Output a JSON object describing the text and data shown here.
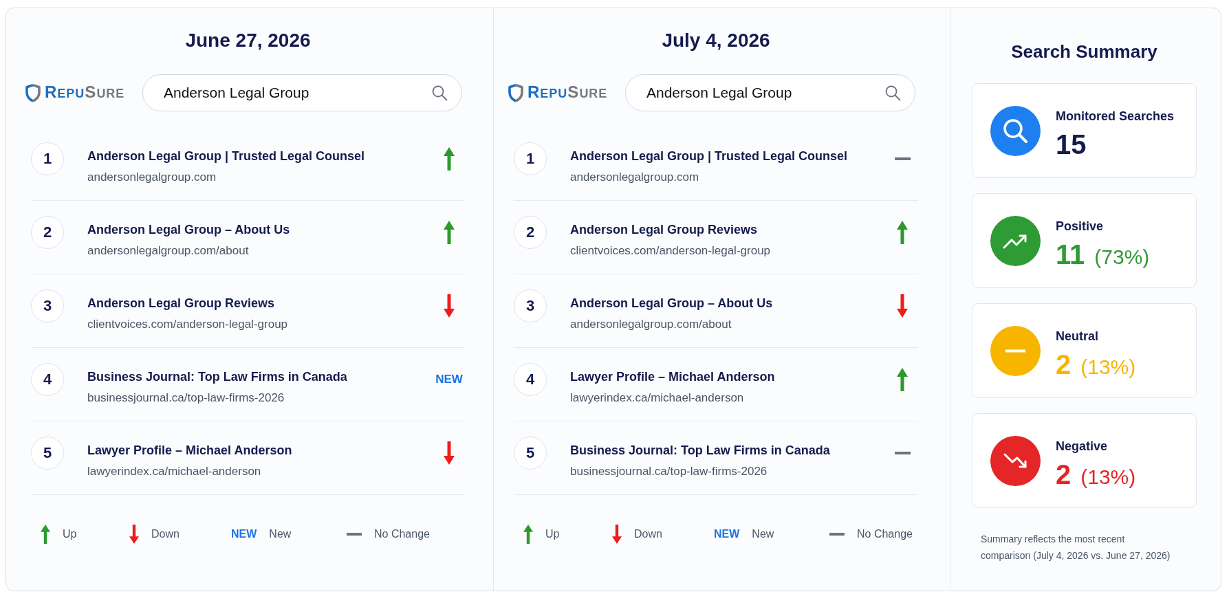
{
  "panels": [
    {
      "date": "June 27, 2026",
      "logo": [
        "REPU",
        "SURE"
      ],
      "query": "Anderson Legal Group",
      "rows": [
        {
          "rank": "1",
          "title": "Anderson Legal Group | Trusted Legal Counsel",
          "url": "andersonlegalgroup.com",
          "kind": "up"
        },
        {
          "rank": "2",
          "title": "Anderson Legal Group – About Us",
          "url": "andersonlegalgroup.com/about",
          "kind": "up"
        },
        {
          "rank": "3",
          "title": "Anderson Legal Group Reviews",
          "url": "clientvoices.com/anderson-legal-group",
          "kind": "down"
        },
        {
          "rank": "4",
          "title": "Business Journal: Top Law Firms in Canada",
          "url": "businessjournal.ca/top-law-firms-2026",
          "kind": "new",
          "badge": "NEW"
        },
        {
          "rank": "5",
          "title": "Lawyer Profile – Michael Anderson",
          "url": "lawyerindex.ca/michael-anderson",
          "kind": "down"
        }
      ],
      "legend": [
        {
          "kind": "up",
          "label": "Up"
        },
        {
          "kind": "down",
          "label": "Down"
        },
        {
          "kind": "new",
          "badge": "NEW",
          "label": "New"
        },
        {
          "kind": "none",
          "label": "No Change"
        }
      ]
    },
    {
      "date": "July 4, 2026",
      "logo": [
        "REPU",
        "SURE"
      ],
      "query": "Anderson Legal Group",
      "rows": [
        {
          "rank": "1",
          "title": "Anderson Legal Group | Trusted Legal Counsel",
          "url": "andersonlegalgroup.com",
          "kind": "none"
        },
        {
          "rank": "2",
          "title": "Anderson Legal Group Reviews",
          "url": "clientvoices.com/anderson-legal-group",
          "kind": "up"
        },
        {
          "rank": "3",
          "title": "Anderson Legal Group – About Us",
          "url": "andersonlegalgroup.com/about",
          "kind": "down"
        },
        {
          "rank": "4",
          "title": "Lawyer Profile – Michael Anderson",
          "url": "lawyerindex.ca/michael-anderson",
          "kind": "up"
        },
        {
          "rank": "5",
          "title": "Business Journal: Top Law Firms in Canada",
          "url": "businessjournal.ca/top-law-firms-2026",
          "kind": "none"
        }
      ],
      "legend": [
        {
          "kind": "up",
          "label": "Up"
        },
        {
          "kind": "down",
          "label": "Down"
        },
        {
          "kind": "new",
          "badge": "NEW",
          "label": "New"
        },
        {
          "kind": "none",
          "label": "No Change"
        }
      ]
    }
  ],
  "summary": {
    "title": "Search Summary",
    "cards": [
      {
        "kind": "search",
        "label": "Monitored Searches",
        "value": "15",
        "color": "#1e80f0"
      },
      {
        "kind": "positive",
        "label": "Positive",
        "value": "11",
        "percent": "(73%)",
        "color": "#2e9b34"
      },
      {
        "kind": "neutral",
        "label": "Neutral",
        "value": "2",
        "percent": "(13%)",
        "color": "#f7b500"
      },
      {
        "kind": "negative",
        "label": "Negative",
        "value": "2",
        "percent": "(13%)",
        "color": "#e52626"
      }
    ],
    "note": "Summary reflects the most recent\ncomparison (July 4, 2026 vs. June 27, 2026)"
  }
}
